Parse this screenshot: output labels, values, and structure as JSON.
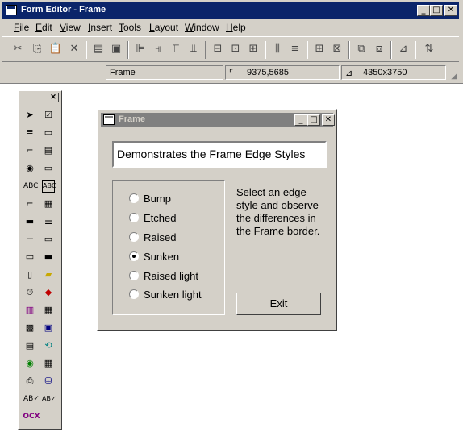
{
  "window": {
    "title": "Form Editor - Frame",
    "min_glyph": "_",
    "max_glyph": "□",
    "close_glyph": "✕"
  },
  "menu": {
    "items": [
      {
        "accel": "F",
        "rest": "ile"
      },
      {
        "accel": "E",
        "rest": "dit"
      },
      {
        "accel": "V",
        "rest": "iew"
      },
      {
        "accel": "I",
        "rest": "nsert"
      },
      {
        "accel": "T",
        "rest": "ools"
      },
      {
        "accel": "L",
        "rest": "ayout"
      },
      {
        "accel": "W",
        "rest": "indow"
      },
      {
        "accel": "H",
        "rest": "elp"
      }
    ]
  },
  "status": {
    "name": "Frame",
    "position": "9375,5685",
    "size": "4350x3750"
  },
  "toolbox": {
    "close_glyph": "✕",
    "ocx_label": "OCX"
  },
  "form": {
    "title": "Frame",
    "min_glyph": "_",
    "max_glyph": "□",
    "close_glyph": "✕",
    "headline": "Demonstrates the Frame Edge Styles",
    "options": [
      {
        "label": "Bump",
        "selected": false
      },
      {
        "label": "Etched",
        "selected": false
      },
      {
        "label": "Raised",
        "selected": false
      },
      {
        "label": "Sunken",
        "selected": true
      },
      {
        "label": "Raised light",
        "selected": false
      },
      {
        "label": "Sunken light",
        "selected": false
      }
    ],
    "instructions": "Select an edge style and observe the differences in the Frame border.",
    "exit_label": "Exit"
  }
}
